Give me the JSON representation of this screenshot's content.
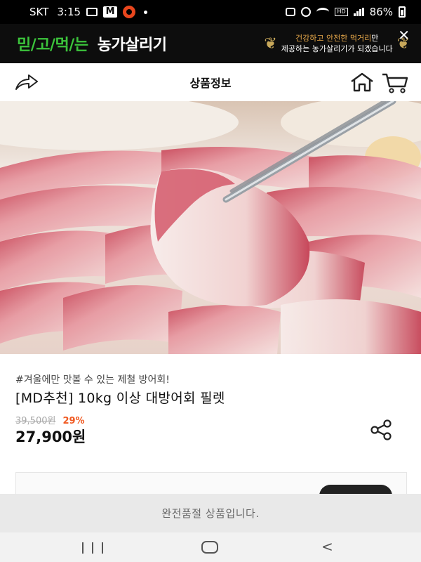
{
  "status_bar": {
    "carrier": "SKT",
    "time": "3:15",
    "m_icon": "M",
    "hd_label": "HD",
    "battery": "86%",
    "icons": [
      "gallery-icon",
      "m-app-icon",
      "o-app-icon",
      "alarm-icon",
      "wifi-icon",
      "signal-icon",
      "battery-icon"
    ]
  },
  "banner": {
    "slogan": "믿/고/먹/는",
    "brand": "농가살리기",
    "copy_highlight": "건강하고 안전한 먹거리",
    "copy_suffix": "만",
    "copy_line2": "제공하는 농가살리기가 되겠습니다",
    "slogan_color": "#3cc43c",
    "highlight_color": "#e8a94a"
  },
  "header": {
    "title": "상품정보",
    "icons": [
      "share-arrow-icon",
      "home-icon",
      "cart-icon"
    ]
  },
  "product": {
    "tagline": "#겨울에만 맛볼 수 있는 제철 방어회!",
    "name": "[MD추천] 10kg 이상 대방어회 필렛",
    "original_price": "39,500원",
    "discount": "29%",
    "sale_price": "27,900원",
    "discount_color": "#f05a22"
  },
  "notice": {
    "sold_out": "완전품절 상품입니다."
  },
  "nav": {
    "icons": [
      "recent-apps-icon",
      "home-circle-icon",
      "back-icon"
    ]
  }
}
